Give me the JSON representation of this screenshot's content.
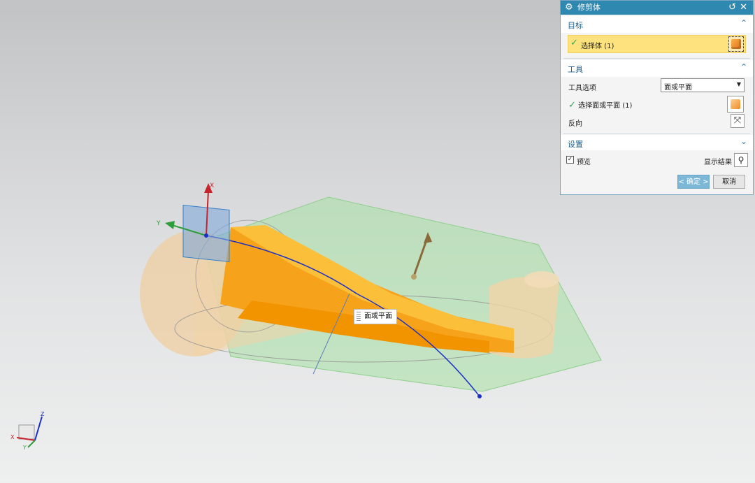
{
  "dialog": {
    "title": "修剪体",
    "target": {
      "section_label": "目标",
      "select_body_label": "选择体 (1)"
    },
    "tool": {
      "section_label": "工具",
      "tool_option_label": "工具选项",
      "tool_option_value": "面或平面",
      "select_face_label": "选择面或平面 (1)",
      "reverse_label": "反向"
    },
    "settings": {
      "section_label": "设置"
    },
    "preview_label": "预览",
    "preview_checked": true,
    "show_result_label": "显示结果",
    "ok_label": "< 确定 >",
    "cancel_label": "取消"
  },
  "viewport": {
    "tooltip_label": "面或平面",
    "axis_x_label": "X",
    "axis_y_label": "Y",
    "triad": {
      "x": "X",
      "y": "Y",
      "z": "Z"
    },
    "colors": {
      "part": "#f7a21b",
      "plane": "#a5e0a3",
      "curve": "#1a2fc8",
      "cylinder": "#f1d3a8",
      "handle_plane": "#7fa8d8"
    }
  }
}
